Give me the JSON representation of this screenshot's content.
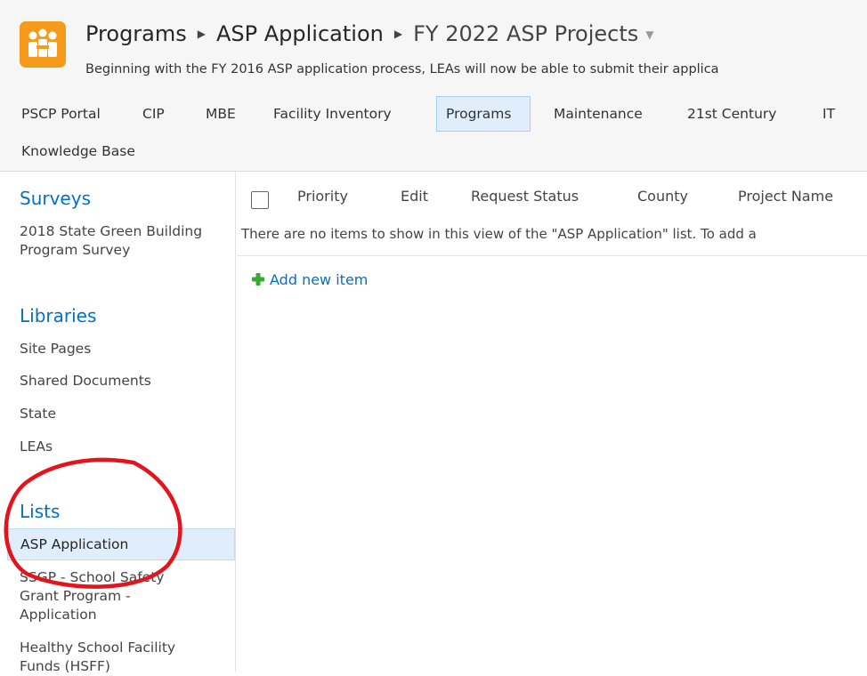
{
  "colors": {
    "accent": "#0072c6",
    "site_icon": "#f59a1a",
    "selected_bg": "#dfeefa",
    "annotation": "#e3141b"
  },
  "header": {
    "site_icon": "people-icon",
    "breadcrumb": [
      "Programs",
      "ASP Application",
      "FY 2022 ASP Projects"
    ],
    "separator_icon": "triangle-right-icon",
    "dropdown_icon": "caret-down-icon",
    "description": "Beginning with the FY 2016 ASP application process, LEAs will now be able to submit their applica"
  },
  "topnav": {
    "items": [
      "PSCP Portal",
      "CIP",
      "MBE",
      "Facility Inventory",
      "Programs",
      "Maintenance",
      "21st Century",
      "IT",
      "Knowledge Base"
    ],
    "selected": "Programs"
  },
  "leftnav": {
    "surveys": {
      "heading": "Surveys",
      "items": [
        "2018 State Green Building Program Survey"
      ]
    },
    "libraries": {
      "heading": "Libraries",
      "items": [
        "Site Pages",
        "Shared Documents",
        "State",
        "LEAs"
      ]
    },
    "lists": {
      "heading": "Lists",
      "items": [
        "ASP Application",
        "SSGP - School Safety Grant Program - Application",
        "Healthy School Facility Funds (HSFF)"
      ],
      "selected": "ASP Application"
    }
  },
  "list": {
    "columns": [
      "Priority",
      "Edit",
      "Request Status",
      "County",
      "Project Name"
    ],
    "empty_message": "There are no items to show in this view of the \"ASP Application\" list. To add a",
    "add_new": "Add new item",
    "add_icon": "green-plus-icon"
  }
}
